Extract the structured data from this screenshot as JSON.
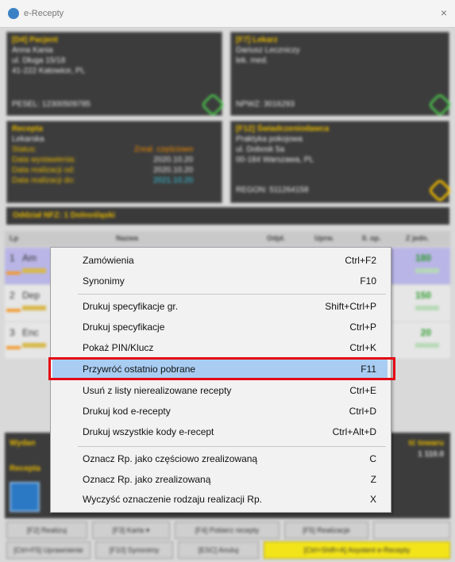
{
  "window": {
    "title": "e-Recepty",
    "close": "×"
  },
  "patient": {
    "header": "[D4] Pacjent",
    "name": "Anna Kania",
    "street": "ul. Długa 15/18",
    "city": "41-222 Katowice, PL",
    "pesel": "PESEL: 12300509785"
  },
  "doctor": {
    "header": "[F7] Lekarz",
    "name": "Dariusz Leczniczy",
    "title": "lek. med.",
    "npwz": "NPWZ: 3016293"
  },
  "prescription": {
    "header": "Recepta",
    "type": "Lekarska",
    "status_label": "Status:",
    "status_value": "Zreal. częściowo",
    "issue_label": "Data wystawienia:",
    "issue_value": "2020.10.20",
    "from_label": "Data realizacji od:",
    "from_value": "2020.10.20",
    "to_label": "Data realizacji do:",
    "to_value": "2021.10.20"
  },
  "provider": {
    "header": "[F12] Świadczeniodawca",
    "name": "Praktyka pokojowa",
    "street": "ul. Dobosk 5a",
    "city": "00-184 Warszawa, PL",
    "regon": "REGON: 511264158"
  },
  "nfz_bar": "Oddział NFZ: 1 Dolnośląski",
  "list": {
    "headers": [
      "Lp",
      "Nazwa",
      "Odpł.",
      "Uprw.",
      "Il. op.",
      "Z jedn."
    ],
    "rows": [
      {
        "num": "1",
        "name": "Am",
        "value": "180"
      },
      {
        "num": "2",
        "name": "Dep",
        "value": "150"
      },
      {
        "num": "3",
        "name": "Enc",
        "value": "20"
      }
    ]
  },
  "lower": {
    "left1": "Wydan",
    "left2": "Recepta",
    "right1": "tć towaru",
    "right2": "1 110.0"
  },
  "footer": {
    "row1": [
      "[F2] Realizuj",
      "[F3] Karta ▾",
      "[F4] Pobierz recepty",
      "[F5] Realizacje",
      ""
    ],
    "row2": [
      "[Ctrl+F5] Uprawnienie",
      "[F10] Synonimy",
      "[ESC] Anuluj",
      "[Ctrl+Shift+A] Asystent e-Recepty"
    ]
  },
  "context_menu": {
    "items": [
      {
        "label": "Zamówienia",
        "shortcut": "Ctrl+F2"
      },
      {
        "label": "Synonimy",
        "shortcut": "F10"
      },
      {
        "label": "Drukuj specyfikacje gr.",
        "shortcut": "Shift+Ctrl+P"
      },
      {
        "label": "Drukuj specyfikacje",
        "shortcut": "Ctrl+P"
      },
      {
        "label": "Pokaż PIN/Klucz",
        "shortcut": "Ctrl+K"
      },
      {
        "label": "Przywróć ostatnio pobrane",
        "shortcut": "F11"
      },
      {
        "label": "Usuń z listy nierealizowane recepty",
        "shortcut": "Ctrl+E"
      },
      {
        "label": "Drukuj kod e-recepty",
        "shortcut": "Ctrl+D"
      },
      {
        "label": "Drukuj wszystkie kody e-recept",
        "shortcut": "Ctrl+Alt+D"
      },
      {
        "label": "Oznacz Rp. jako częściowo zrealizowaną",
        "shortcut": "C"
      },
      {
        "label": "Oznacz Rp. jako zrealizowaną",
        "shortcut": "Z"
      },
      {
        "label": "Wyczyść oznaczenie rodzaju realizacji Rp.",
        "shortcut": "X"
      }
    ]
  }
}
